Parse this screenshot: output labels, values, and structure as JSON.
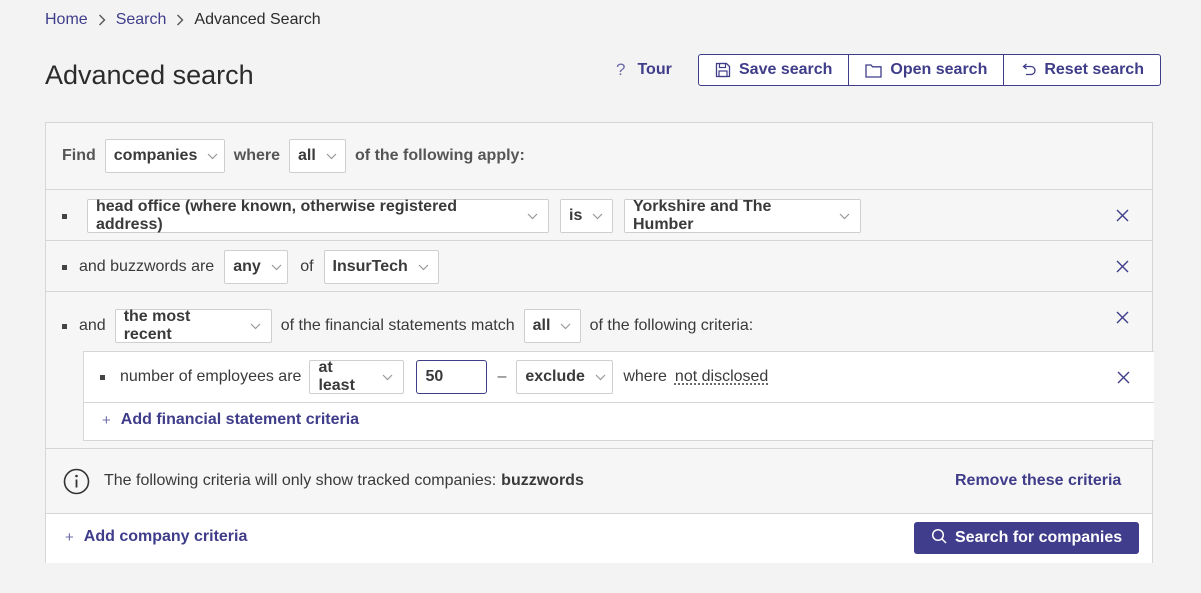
{
  "breadcrumb": {
    "home": "Home",
    "search": "Search",
    "current": "Advanced Search"
  },
  "page_title": "Advanced search",
  "toolbar": {
    "tour": "Tour",
    "tour_icon": "?",
    "save": "Save search",
    "open": "Open search",
    "reset": "Reset search"
  },
  "find_row": {
    "find": "Find",
    "entity": "companies",
    "where": "where",
    "quantifier": "all",
    "suffix": "of the following apply:"
  },
  "criteria": [
    {
      "field": "head office (where known, otherwise registered address)",
      "operator": "is",
      "value": "Yorkshire and The Humber"
    },
    {
      "prefix": "and buzzwords are",
      "quantifier": "any",
      "of": "of",
      "value": "InsurTech"
    },
    {
      "prefix": "and",
      "period": "the most recent",
      "mid": "of the financial statements match",
      "quantifier": "all",
      "suffix": "of the following criteria:",
      "sub": {
        "label": "number of employees are",
        "comparator": "at least",
        "value": "50",
        "dash": "–",
        "exclude": "exclude",
        "where": "where",
        "not_disclosed": "not disclosed"
      },
      "add_label": "Add financial statement criteria"
    }
  ],
  "notice": {
    "text": "The following criteria will only show tracked companies:",
    "bold": "buzzwords",
    "remove": "Remove these criteria"
  },
  "footer": {
    "add": "Add company criteria",
    "search": "Search for companies",
    "plus": "+"
  },
  "colors": {
    "accent": "#3f3d8a",
    "primary_button": "#403d8c"
  }
}
